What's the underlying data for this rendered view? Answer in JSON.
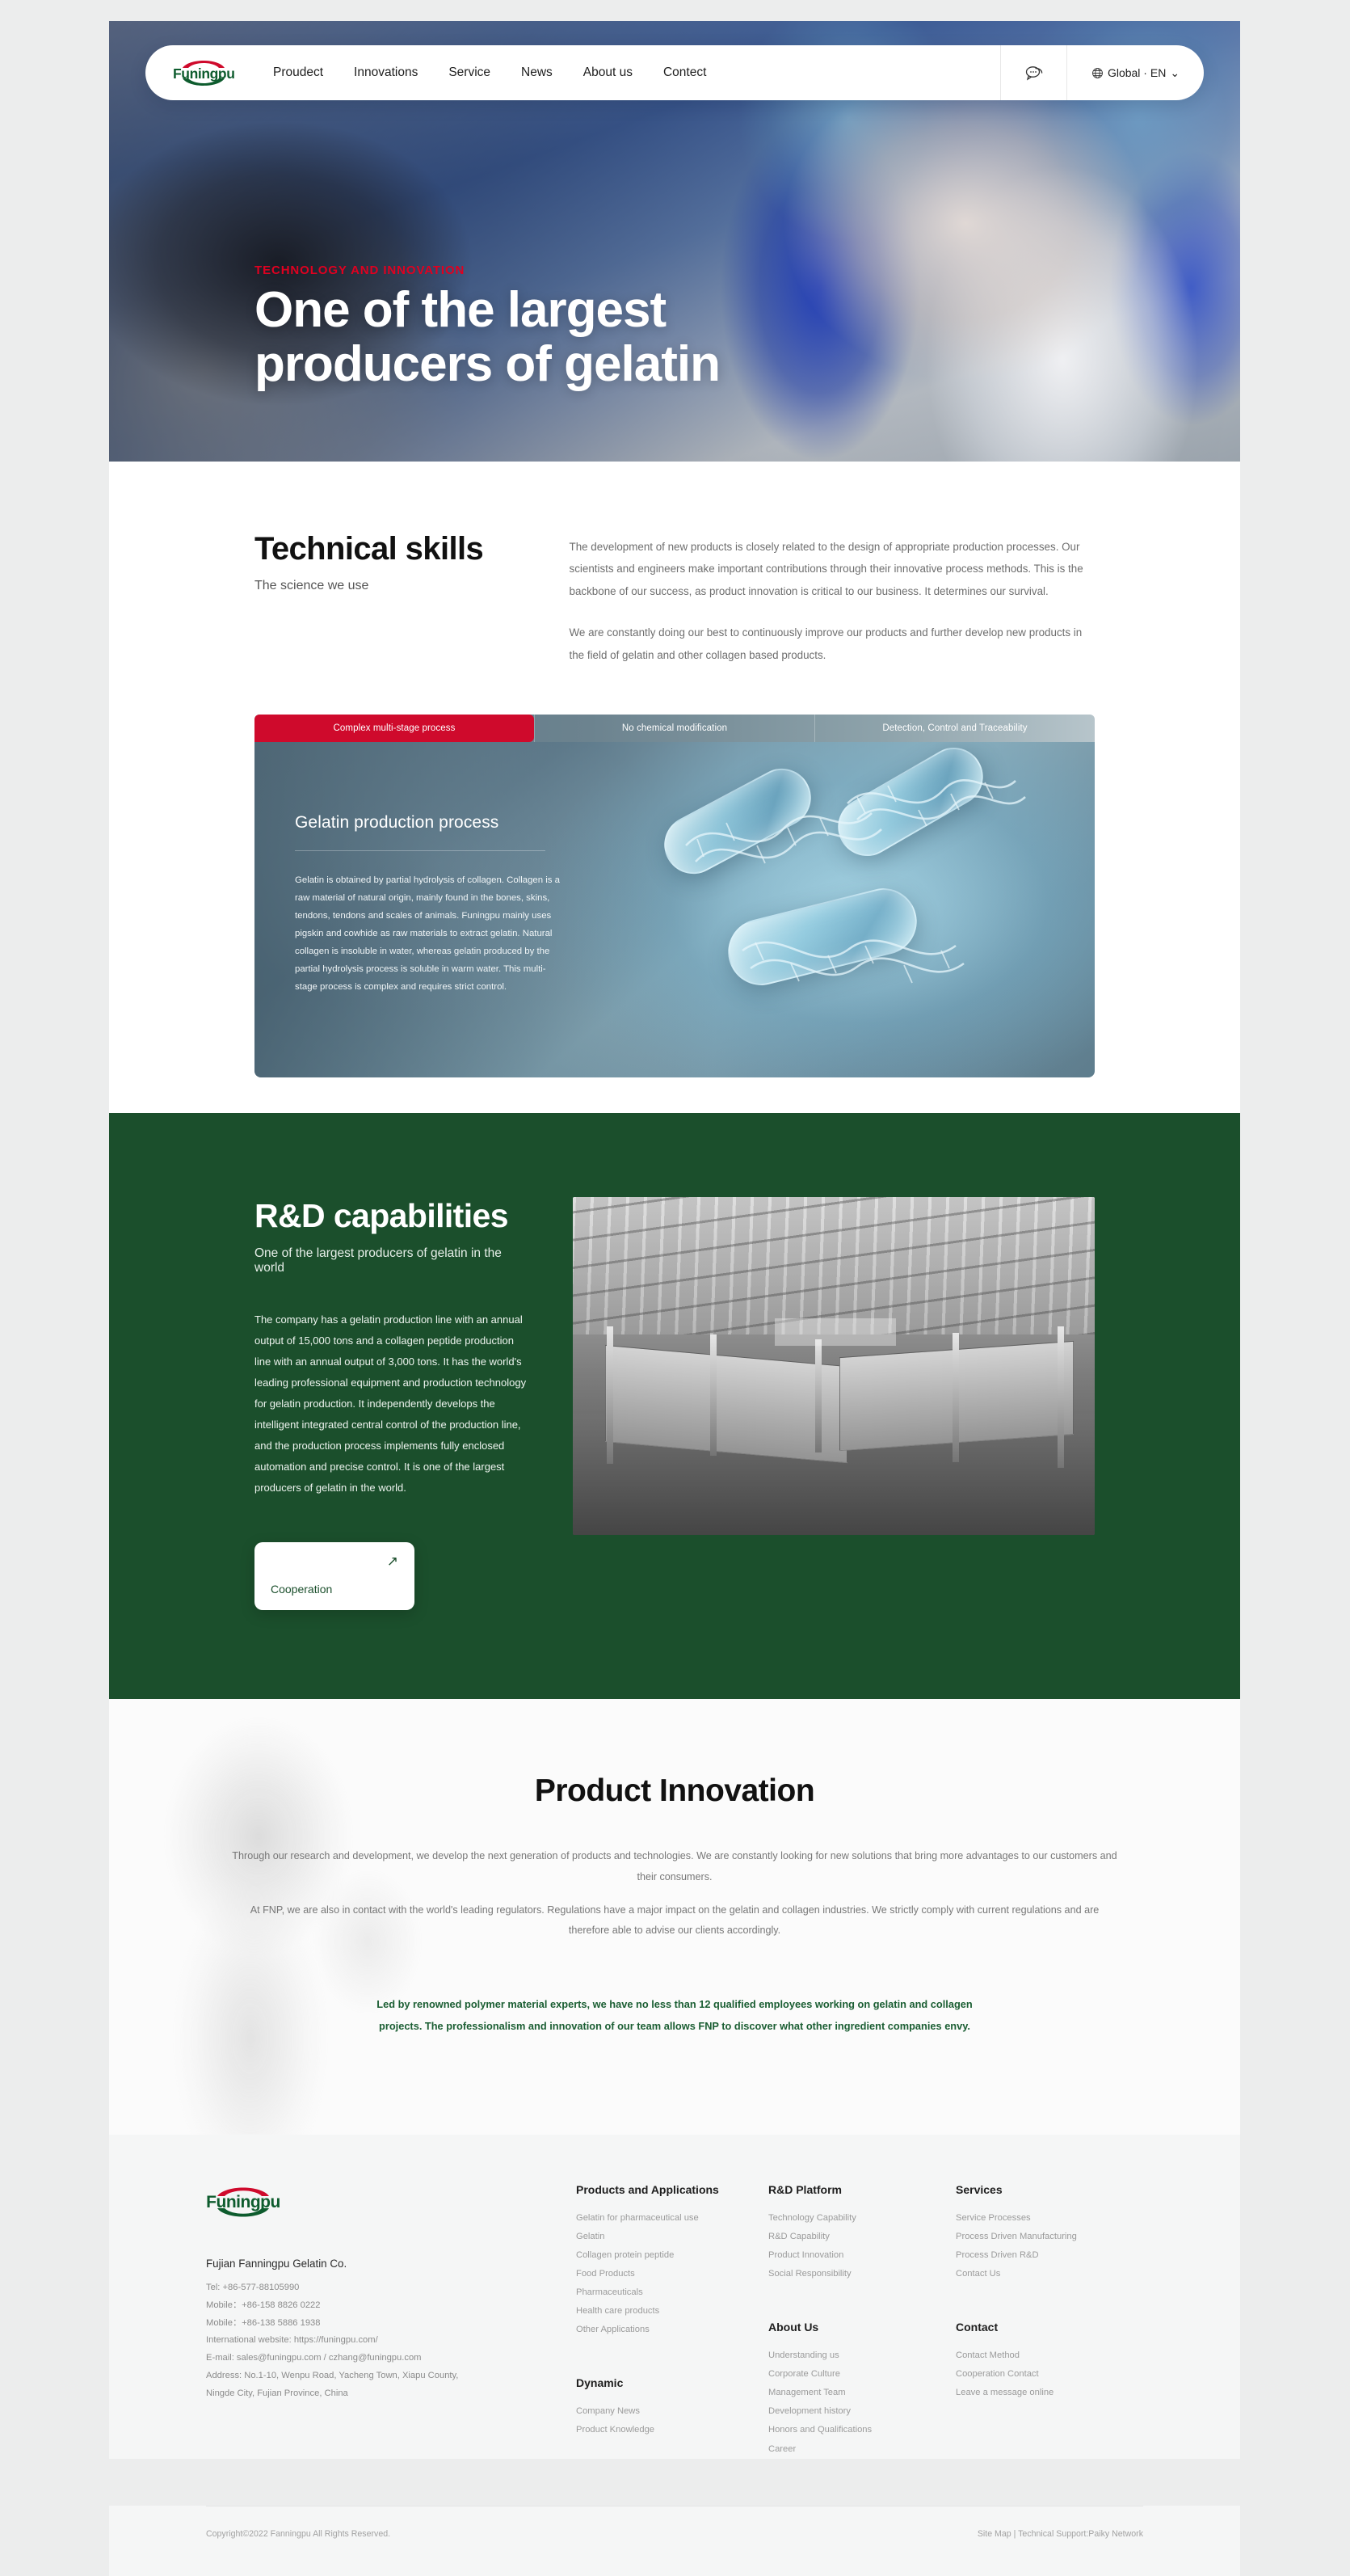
{
  "nav": {
    "logo_text": "Funingpu",
    "links": [
      {
        "label": "Proudect"
      },
      {
        "label": "Innovations"
      },
      {
        "label": "Service"
      },
      {
        "label": "News"
      },
      {
        "label": "About us"
      },
      {
        "label": "Contect"
      }
    ],
    "chat_icon": "chat-bubble-icon",
    "lang": {
      "globe_icon": "globe-icon",
      "label": "Global · EN",
      "caret": "⌄"
    }
  },
  "hero": {
    "eyebrow": "TECHNOLOGY AND INNOVATION",
    "title_line1": "One of the largest",
    "title_line2": "producers of gelatin",
    "eyebrow_color": "#e00020"
  },
  "technical": {
    "heading": "Technical skills",
    "subheading": "The science we use",
    "paragraph1": "The development of new products is closely related to the design of appropriate production processes. Our scientists and engineers make important contributions through their innovative process methods. This is the backbone of our success, as product innovation is critical to our business. It determines our survival.",
    "paragraph2": "We are constantly doing our best to continuously improve our products and further develop new products in the field of gelatin and other collagen based products."
  },
  "process": {
    "tabs": [
      {
        "label": "Complex multi-stage process",
        "active": true
      },
      {
        "label": "No chemical modification",
        "active": false
      },
      {
        "label": "Detection, Control and Traceability",
        "active": false
      }
    ],
    "active_color": "#cf0a2c",
    "panel_heading": "Gelatin production process",
    "panel_text": "Gelatin is obtained by partial hydrolysis of collagen. Collagen is a raw material of natural origin, mainly found in the bones, skins, tendons, tendons and scales of animals. Funingpu mainly uses pigskin and cowhide as raw materials to extract gelatin. Natural collagen is insoluble in water, whereas gelatin produced by the partial hydrolysis process is soluble in warm water. This multi-stage process is complex and requires strict control."
  },
  "rnd": {
    "heading": "R&D capabilities",
    "subheading": "One of the largest producers of gelatin in the world",
    "paragraph": "The company has a gelatin production line with an annual output of 15,000 tons and a collagen peptide production line with an annual output of 3,000 tons. It has the world's leading professional equipment and production technology for gelatin production. It independently develops the intelligent integrated central control of the production line, and the production process implements fully enclosed automation and precise control. It is one of the largest producers of gelatin in the world.",
    "button_label": "Cooperation",
    "button_icon": "arrow-up-right-icon",
    "background_color": "#1b4f2c",
    "image_alt": "factory-production-line-photo"
  },
  "innovation": {
    "heading": "Product Innovation",
    "paragraph1": "Through our research and development, we develop the next generation of products and technologies. We are constantly looking for new solutions that bring more advantages to our customers and their consumers.",
    "paragraph2": "At FNP, we are also in contact with the world's leading regulators. Regulations have a major impact on the gelatin and collagen industries. We strictly comply with current regulations and are therefore able to advise our clients accordingly.",
    "highlight": "Led by renowned polymer material experts, we have no less than 12 qualified employees working on gelatin and collagen projects. The professionalism and innovation of our team allows FNP to discover what other ingredient companies envy.",
    "highlight_color": "#1b5e33"
  },
  "footer": {
    "logo_text": "Funingpu",
    "company": "Fujian Fanningpu Gelatin Co.",
    "contact_lines": [
      "Tel: +86-577-88105990",
      "Mobile：+86-158 8826 0222",
      "Mobile：+86-138 5886 1938",
      "International website: https://funingpu.com/",
      "E-mail: sales@funingpu.com / czhang@funingpu.com",
      "Address: No.1-10, Wenpu Road, Yacheng Town, Xiapu County,",
      "Ningde City, Fujian Province, China"
    ],
    "columns": [
      {
        "heading": "Products and Applications",
        "items": [
          "Gelatin for pharmaceutical use",
          "Gelatin",
          "Collagen protein peptide",
          "Food Products",
          "Pharmaceuticals",
          "Health care products",
          "Other Applications"
        ],
        "heading2": "Dynamic",
        "items2": [
          "Company News",
          "Product Knowledge"
        ]
      },
      {
        "heading": "R&D Platform",
        "items": [
          "Technology Capability",
          "R&D Capability",
          "Product Innovation",
          "Social Responsibility"
        ],
        "heading2": "About Us",
        "items2": [
          "Understanding us",
          "Corporate Culture",
          "Management Team",
          "Development history",
          "Honors and Qualifications",
          "Career"
        ]
      },
      {
        "heading": "Services",
        "items": [
          "Service Processes",
          "Process Driven Manufacturing",
          "Process Driven R&D",
          "Contact Us"
        ],
        "heading2": "Contact",
        "items2": [
          "Contact Method",
          "Cooperation Contact",
          "Leave a message online"
        ]
      }
    ],
    "copyright": "Copyright©2022 Fanningpu All Rights Reserved.",
    "site_map": "Site Map",
    "separator": "|",
    "tech_support": "Technical Support:Paiky Network"
  }
}
